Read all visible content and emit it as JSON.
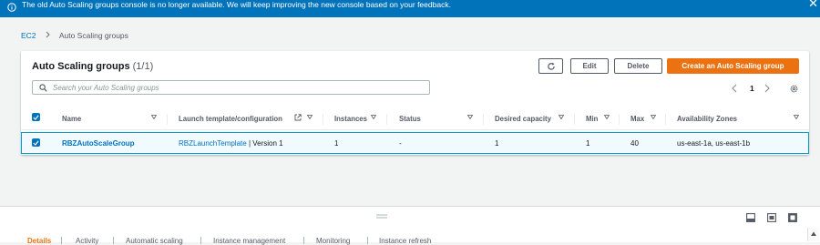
{
  "banner": {
    "message": "The old Auto Scaling groups console is no longer available. We will keep improving the new console based on your feedback.",
    "close": "✕"
  },
  "breadcrumb": {
    "root": "EC2",
    "current": "Auto Scaling groups"
  },
  "panel": {
    "title": "Auto Scaling groups",
    "count": "(1/1)",
    "edit_label": "Edit",
    "delete_label": "Delete",
    "create_label": "Create an Auto Scaling group",
    "search_placeholder": "Search your Auto Scaling groups",
    "page": "1"
  },
  "table": {
    "columns": [
      "Name",
      "Launch template/configuration",
      "Instances",
      "Status",
      "Desired capacity",
      "Min",
      "Max",
      "Availability Zones"
    ],
    "rows": [
      {
        "name": "RBZAutoScaleGroup",
        "launch_template": "RBZLaunchTemplate",
        "version": "| Version 1",
        "instances": "1",
        "status": "-",
        "desired": "1",
        "min": "1",
        "max": "40",
        "zones": "us-east-1a, us-east-1b",
        "selected": true
      }
    ]
  },
  "lower_panel": {
    "tabs": [
      "Details",
      "Activity",
      "Automatic scaling",
      "Instance management",
      "Monitoring",
      "Instance refresh"
    ],
    "active_tab": "Details"
  },
  "colors": {
    "banner": "#0073bb",
    "primary_button": "#ec7211",
    "link": "#0073bb",
    "selected_row": "#f1faff"
  }
}
